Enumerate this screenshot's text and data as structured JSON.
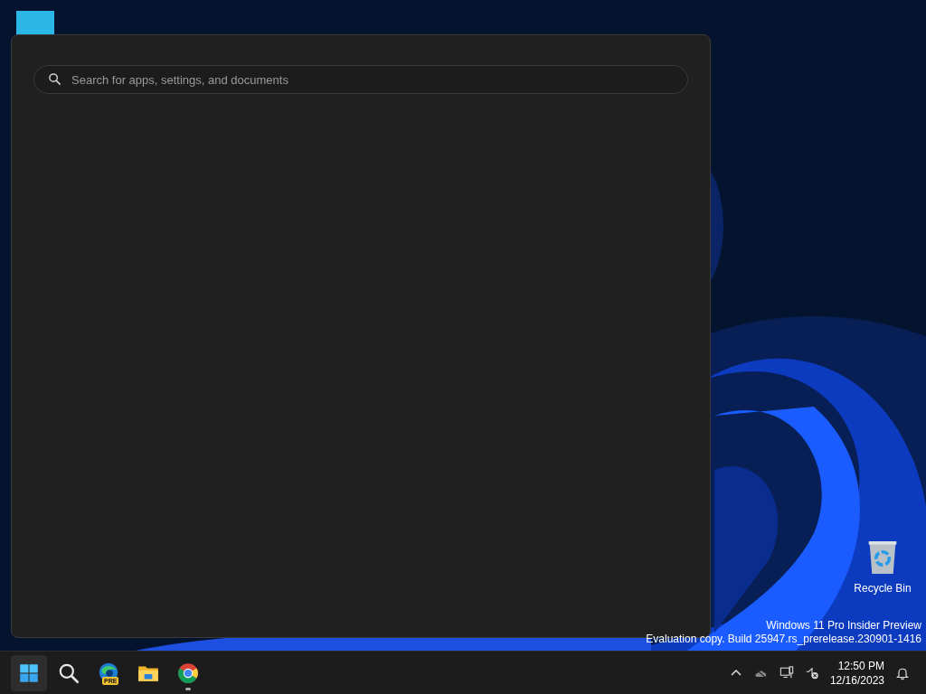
{
  "start_panel": {
    "search": {
      "placeholder": "Search for apps, settings, and documents"
    }
  },
  "desktop_icons": [
    {
      "kind": "recycle-bin",
      "label": "Recycle Bin"
    }
  ],
  "watermark": {
    "edition": "Windows 11 Pro Insider Preview",
    "build": "Evaluation copy. Build 25947.rs_prerelease.230901-1416"
  },
  "taskbar": {
    "items": [
      {
        "kind": "start",
        "selected": true,
        "running": false
      },
      {
        "kind": "search",
        "selected": false,
        "running": false
      },
      {
        "kind": "edge",
        "badge": "PRE",
        "selected": false,
        "running": false
      },
      {
        "kind": "explorer",
        "selected": false,
        "running": false
      },
      {
        "kind": "chrome",
        "selected": false,
        "running": true
      }
    ],
    "tray": {
      "time": "12:50 PM",
      "date": "12/16/2023"
    }
  }
}
